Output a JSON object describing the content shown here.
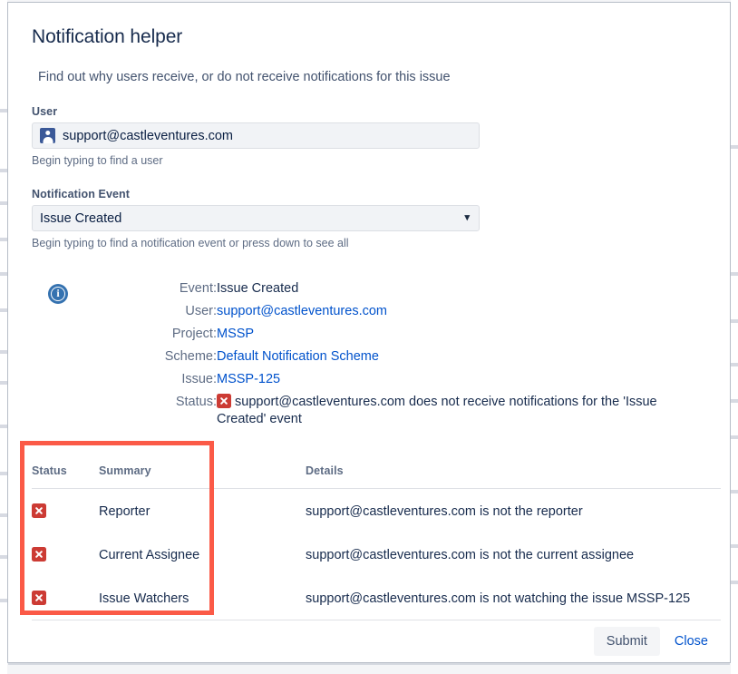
{
  "dialog": {
    "title": "Notification helper",
    "intro": "Find out why users receive, or do not receive notifications for this issue"
  },
  "user_field": {
    "label": "User",
    "value": "support@castleventures.com",
    "hint": "Begin typing to find a user",
    "icon": "user-avatar-icon"
  },
  "event_field": {
    "label": "Notification Event",
    "value": "Issue Created",
    "hint": "Begin typing to find a notification event or press down to see all",
    "icon": "chevron-down-icon"
  },
  "info": {
    "icon": "info-circle-icon",
    "rows": [
      {
        "label": "Event:",
        "value": "Issue Created",
        "link": false
      },
      {
        "label": "User:",
        "value": "support@castleventures.com",
        "link": true
      },
      {
        "label": "Project:",
        "value": "MSSP",
        "link": true
      },
      {
        "label": "Scheme:",
        "value": "Default Notification Scheme",
        "link": true
      },
      {
        "label": "Issue:",
        "value": "MSSP-125",
        "link": true
      }
    ],
    "status_label": "Status:",
    "status_text": "support@castleventures.com does not receive notifications for the 'Issue Created' event",
    "status_icon": "red-x-icon"
  },
  "results_table": {
    "headers": [
      "Status",
      "Summary",
      "Details"
    ],
    "rows": [
      {
        "status_icon": "red-x-icon",
        "summary": "Reporter",
        "details": "support@castleventures.com is not the reporter"
      },
      {
        "status_icon": "red-x-icon",
        "summary": "Current Assignee",
        "details": "support@castleventures.com is not the current assignee"
      },
      {
        "status_icon": "red-x-icon",
        "summary": "Issue Watchers",
        "details": "support@castleventures.com is not watching the issue MSSP-125"
      }
    ]
  },
  "footer": {
    "submit_label": "Submit",
    "close_label": "Close"
  },
  "annotation": {
    "highlight_color": "#fb5a47"
  },
  "colors": {
    "link": "#0052cc",
    "error_red": "#cc3b34",
    "heading": "#172b4d",
    "subtle_text": "#5e6c84",
    "field_bg": "#f1f3f6"
  }
}
